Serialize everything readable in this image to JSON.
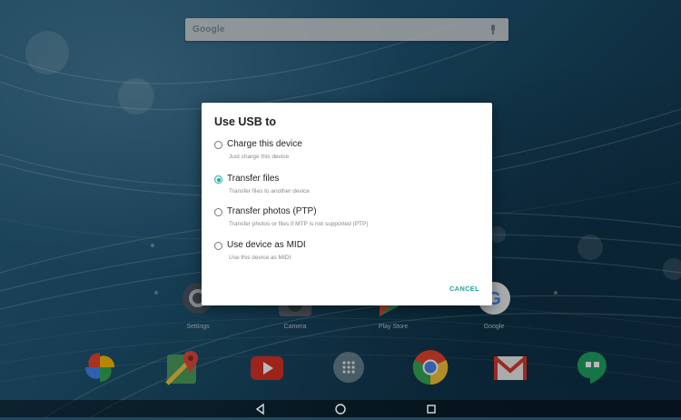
{
  "search": {
    "logo_text": "Google"
  },
  "home_apps": [
    {
      "label": "Settings",
      "icon": "settings-icon"
    },
    {
      "label": "Camera",
      "icon": "camera-icon"
    },
    {
      "label": "Play Store",
      "icon": "play-store-icon"
    },
    {
      "label": "Google",
      "icon": "google-icon"
    }
  ],
  "dock_apps": [
    {
      "icon": "photos-icon"
    },
    {
      "icon": "maps-icon"
    },
    {
      "icon": "youtube-icon"
    },
    {
      "icon": "all-apps-icon"
    },
    {
      "icon": "chrome-icon"
    },
    {
      "icon": "gmail-icon"
    },
    {
      "icon": "hangouts-icon"
    }
  ],
  "dialog": {
    "title": "Use USB to",
    "selected_index": 1,
    "options": [
      {
        "title": "Charge this device",
        "subtitle": "Just charge this device"
      },
      {
        "title": "Transfer files",
        "subtitle": "Transfer files to another device"
      },
      {
        "title": "Transfer photos (PTP)",
        "subtitle": "Transfer photos or files if MTP is not supported (PTP)"
      },
      {
        "title": "Use device as MIDI",
        "subtitle": "Use this device as MIDI"
      }
    ],
    "cancel_label": "CANCEL"
  },
  "nav": {
    "buttons": [
      "back-icon",
      "home-icon",
      "recents-icon"
    ]
  },
  "colors": {
    "accent": "#21a599",
    "wallpaper": "#1f5573"
  }
}
